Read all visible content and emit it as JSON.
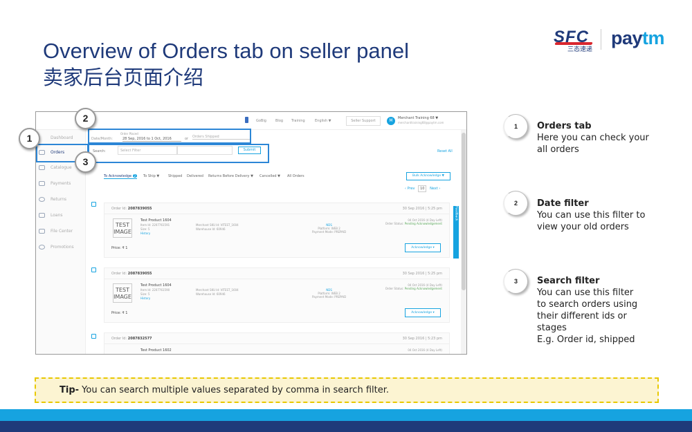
{
  "slide": {
    "title": "Overview of Orders tab on seller panel",
    "subtitle": "卖家后台页面介绍"
  },
  "logos": {
    "sfc": "SFC",
    "sfc_cn": "三态速递",
    "paytm_pay": "pay",
    "paytm_tm": "tm"
  },
  "panel": {
    "topbar": {
      "links": [
        "GoBig",
        "Blog",
        "Training",
        "English ▼"
      ],
      "support": "Seller Support",
      "avatar": "M",
      "user_name": "Merchant Training 68 ▼",
      "user_email": "merchanttraining68@paytm.com"
    },
    "sidebar": [
      {
        "label": "Dashboard"
      },
      {
        "label": "Orders"
      },
      {
        "label": "Catalogue"
      },
      {
        "label": "Payments"
      },
      {
        "label": "Returns"
      },
      {
        "label": "Loans"
      },
      {
        "label": "File Center"
      },
      {
        "label": "Promotions"
      }
    ],
    "filters": {
      "date_caption": "Order Placed",
      "date_label": "Date/Month:",
      "date_value": "28 Sep, 2016 to 1 Oct, 2016",
      "or": "or",
      "shipped_value": "Orders Shipped",
      "search_label": "Search:",
      "search_select": "Select Filter",
      "submit": "Submit",
      "reset_all": "Reset All"
    },
    "tabs": {
      "acknowledge": "To Acknowledge",
      "ack_count": "2",
      "to_ship": "To Ship ▼",
      "shipped": "Shipped",
      "delivered": "Delivered",
      "returns": "Returns Before Delivery ▼",
      "cancelled": "Cancelled ▼",
      "all": "All Orders"
    },
    "bulk_ack": "Bulk Acknowledge ▼",
    "pager": {
      "prev": "‹ Prev",
      "page": "10",
      "next": "Next ›"
    },
    "orders": [
      {
        "id": "2087839055",
        "id_label": "Order Id:",
        "date": "30 Sep 2016 | 5:25 pm",
        "product": "Test Product 1604",
        "item_id": "Item Id: 2207761591",
        "size": "Size: 5",
        "history": "History",
        "msku": "Merchant SKU Id: VITEST_1604",
        "warehouse": "Warehouse Id: 60946",
        "nds": "NDS",
        "platform": "Platform: WEB 2",
        "payment": "Payment Mode: PREPAID",
        "ship_by": "04 Oct 2016 (4 Day Left)",
        "status_label": "Order Status:",
        "status": "Pending Acknowledgement",
        "price": "Price: ₹ 1",
        "ack": "Acknowledge ▾",
        "img": "TEST IMAGE"
      },
      {
        "id": "2087839055",
        "id_label": "Order Id:",
        "date": "30 Sep 2016 | 5:25 pm",
        "product": "Test Product 1604",
        "item_id": "Item Id: 2207761590",
        "size": "Size: 5",
        "history": "History",
        "msku": "Merchant SKU Id: VITEST_1604",
        "warehouse": "Warehouse Id: 60946",
        "nds": "NDS",
        "platform": "Platform: WEB 2",
        "payment": "Payment Mode: PREPAID",
        "ship_by": "04 Oct 2016 (4 Day Left)",
        "status_label": "Order Status:",
        "status": "Pending Acknowledgement",
        "price": "Price: ₹ 1",
        "ack": "Acknowledge ▾",
        "img": "TEST IMAGE"
      },
      {
        "id": "2087832577",
        "id_label": "Order Id:",
        "date": "30 Sep 2016 | 5:23 pm",
        "product": "Test Product 1602",
        "ship_by": "04 Oct 2016 (4 Day Left)"
      }
    ],
    "feedback": "Feedback"
  },
  "callouts": [
    {
      "num": "1",
      "heading": "Orders tab",
      "text": "Here you can check your all orders"
    },
    {
      "num": "2",
      "heading": "Date filter",
      "text": "You can use this filter to view your old orders"
    },
    {
      "num": "3",
      "heading": "Search filter",
      "text": "You can use this filter to search orders using their different ids or stages",
      "example": "E.g. Order id, shipped"
    }
  ],
  "tip": {
    "label": "Tip-",
    "text": " You can search multiple values separated by comma in search filter."
  },
  "colors": {
    "title": "#1f3a7a",
    "accent": "#16a3e0",
    "highlight": "#2c86d6",
    "tip_bg": "#fcf4d2",
    "tip_border": "#e8c800"
  }
}
